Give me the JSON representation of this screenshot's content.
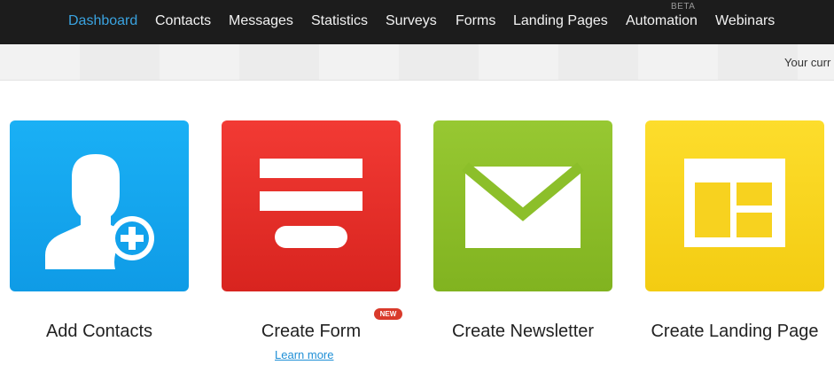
{
  "nav": {
    "items": [
      {
        "label": "Dashboard",
        "active": true
      },
      {
        "label": "Contacts"
      },
      {
        "label": "Messages"
      },
      {
        "label": "Statistics"
      },
      {
        "label": "Surveys"
      },
      {
        "label": "Forms"
      },
      {
        "label": "Landing Pages"
      },
      {
        "label": "Automation",
        "badge": "BETA"
      },
      {
        "label": "Webinars"
      }
    ],
    "active_color": "#3aa3e0"
  },
  "subbar": {
    "text": "Your curr"
  },
  "tiles": [
    {
      "label": "Add Contacts",
      "icon": "add-contact-icon",
      "color": "#1aa8f0"
    },
    {
      "label": "Create Form",
      "icon": "form-icon",
      "color": "#e42e29",
      "badge": "NEW",
      "link": "Learn more"
    },
    {
      "label": "Create Newsletter",
      "icon": "envelope-icon",
      "color": "#8cbf2a"
    },
    {
      "label": "Create Landing Page",
      "icon": "landing-page-icon",
      "color": "#f8d420"
    }
  ]
}
